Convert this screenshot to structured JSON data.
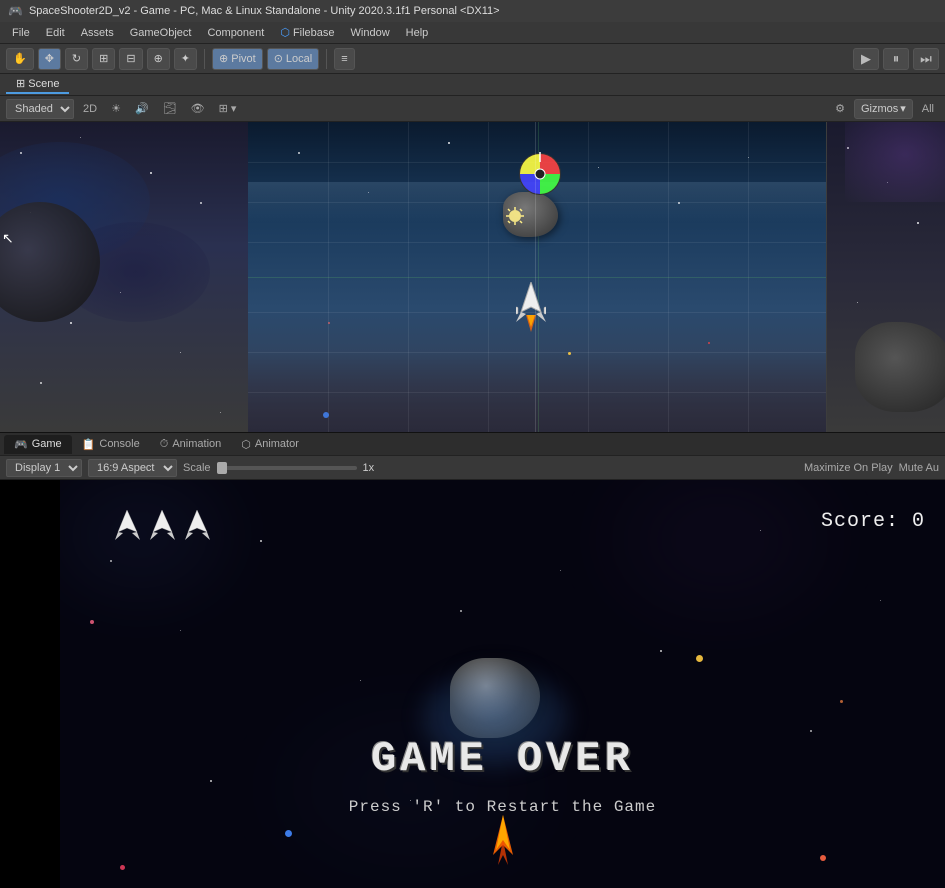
{
  "title_bar": {
    "icon": "🎮",
    "text": "SpaceShooter2D_v2 - Game - PC, Mac & Linux Standalone - Unity 2020.3.1f1 Personal <DX11>"
  },
  "menu_bar": {
    "items": [
      "File",
      "Edit",
      "Assets",
      "GameObject",
      "Component",
      "Filebase",
      "Window",
      "Help"
    ]
  },
  "toolbar": {
    "transform_tools": [
      "⊕",
      "✥",
      "↩",
      "⬜",
      "⊡",
      "⊕"
    ],
    "pivot_label": "Pivot",
    "local_label": "Local",
    "layers_label": "≡",
    "play_icon": "▶",
    "pause_icon": "⏸",
    "step_icon": "⏭"
  },
  "scene": {
    "tab_label": "Scene",
    "shading_options": [
      "Shaded"
    ],
    "mode_2d": "2D",
    "gizmos_label": "Gizmos",
    "all_label": "All"
  },
  "game_tabs": [
    {
      "label": "Game",
      "icon": "🎮",
      "active": true
    },
    {
      "label": "Console",
      "icon": "📋",
      "active": false
    },
    {
      "label": "Animation",
      "icon": "⏱",
      "active": false
    },
    {
      "label": "Animator",
      "icon": "⬡",
      "active": false
    }
  ],
  "game_toolbar": {
    "display_label": "Display 1",
    "aspect_label": "16:9 Aspect",
    "scale_label": "Scale",
    "scale_value": "1x",
    "maximize_label": "Maximize On Play",
    "mute_label": "Mute Au"
  },
  "game_viewport": {
    "score_label": "Score: 0",
    "game_over_label": "GAME OVER",
    "restart_label": "Press 'R' to Restart the Game",
    "lives_count": 3
  }
}
